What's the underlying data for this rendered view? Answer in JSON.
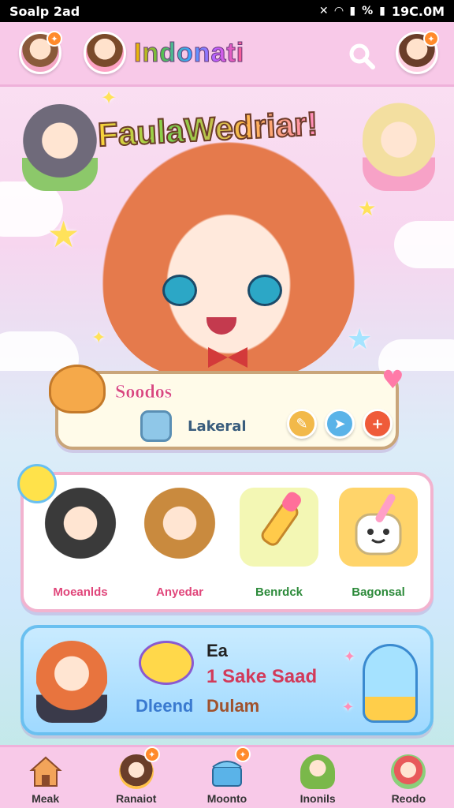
{
  "status_bar": {
    "left_text": "Soalp 2ad",
    "right_text": "19C.0M",
    "battery_text": "%"
  },
  "header": {
    "title": "Indonati"
  },
  "hero": {
    "title": "FaulaWedriar!"
  },
  "profile": {
    "name": "Soodos",
    "subtitle": "Lakeral"
  },
  "gallery": {
    "items": [
      {
        "label": "Moeanlds",
        "color": "#e0457a"
      },
      {
        "label": "Anyedar",
        "color": "#e0457a"
      },
      {
        "label": "Benrdck",
        "color": "#2c8a3a"
      },
      {
        "label": "Bagonsal",
        "color": "#2c8a3a"
      }
    ]
  },
  "promo": {
    "line1": "Ea",
    "line2": "1 Sake Saad",
    "line3a": "Dleend",
    "line3b": "Dulam"
  },
  "bottom_nav": {
    "items": [
      {
        "label": "Meak",
        "icon": "house-icon"
      },
      {
        "label": "Ranaiot",
        "icon": "character-icon"
      },
      {
        "label": "Moonto",
        "icon": "shop-icon"
      },
      {
        "label": "Inonils",
        "icon": "friend-icon"
      },
      {
        "label": "Reodo",
        "icon": "gift-icon"
      }
    ]
  },
  "colors": {
    "accent_pink": "#f8c9e8",
    "badge_orange": "#ff8a2b",
    "promo_blue": "#6ac0f0"
  }
}
